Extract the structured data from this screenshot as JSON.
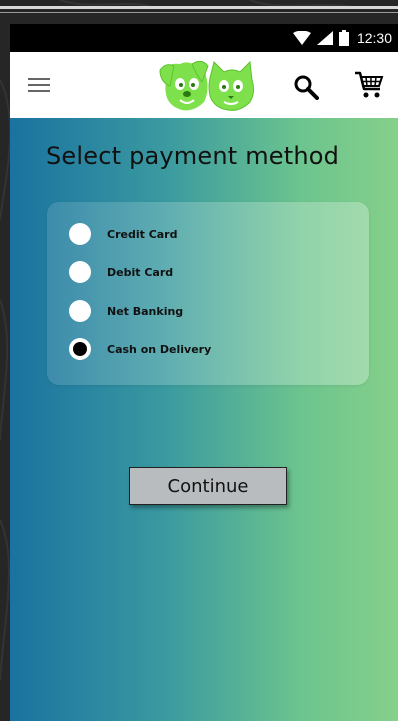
{
  "status_bar": {
    "time": "12:30",
    "icons": [
      "wifi-icon",
      "signal-icon",
      "battery-icon"
    ]
  },
  "app_bar": {
    "menu_icon": "hamburger-menu-icon",
    "logo": "dog-cat-logo",
    "search_icon": "search-icon",
    "cart_icon": "shopping-cart-icon"
  },
  "page": {
    "title": "Select payment method"
  },
  "payment": {
    "options": [
      {
        "label": "Credit Card",
        "selected": false
      },
      {
        "label": "Debit Card",
        "selected": false
      },
      {
        "label": "Net Banking",
        "selected": false
      },
      {
        "label": "Cash on Delivery",
        "selected": true
      }
    ]
  },
  "actions": {
    "continue_label": "Continue"
  },
  "colors": {
    "gradient_start": "#1a72a0",
    "gradient_end": "#86d08a",
    "logo_green": "#7ee04a",
    "app_bar": "#ffffff",
    "status_bar": "#000000",
    "button_bg": "#b9bcbf"
  }
}
